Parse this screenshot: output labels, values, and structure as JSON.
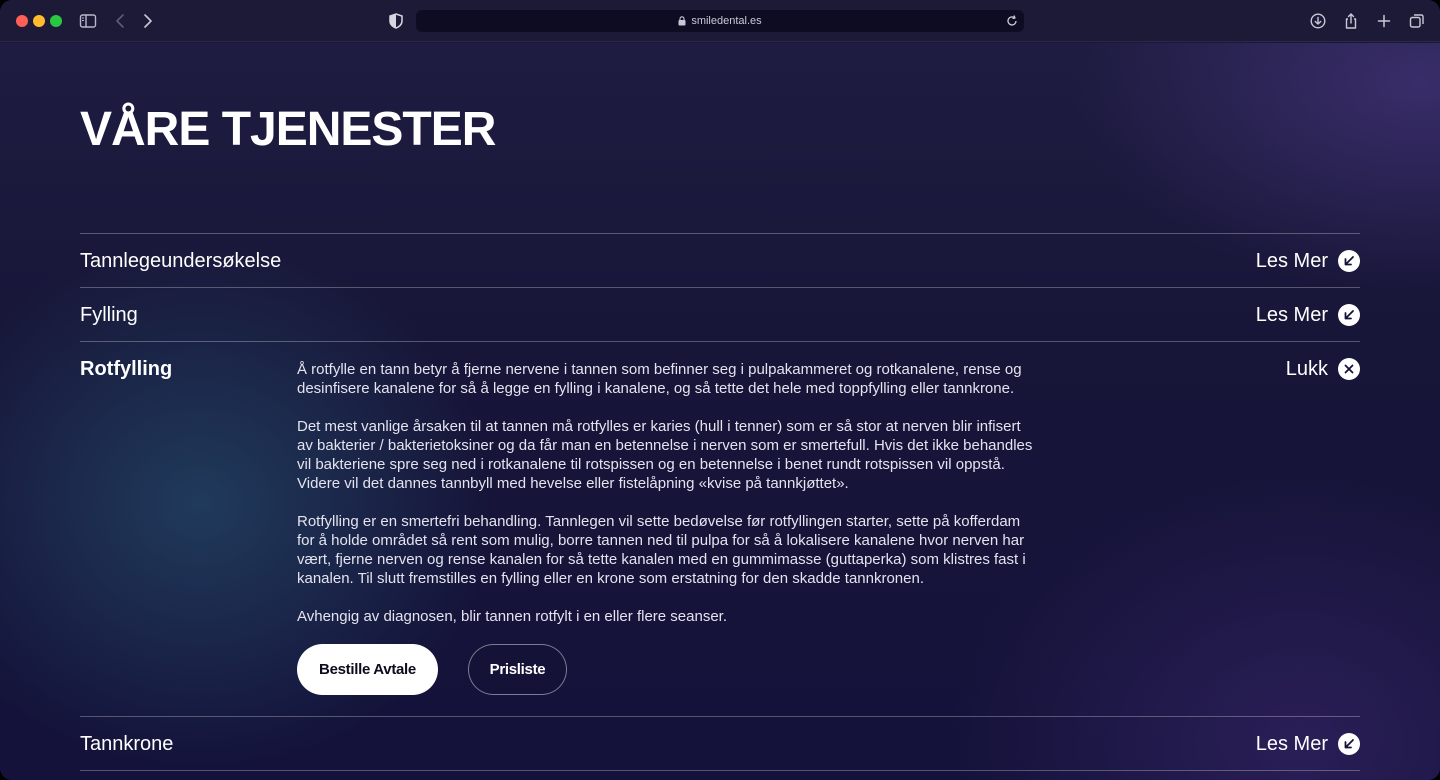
{
  "browser": {
    "url": "smiledental.es"
  },
  "page": {
    "title": "VÅRE TJENESTER"
  },
  "services": [
    {
      "name": "Tannlegeundersøkelse",
      "action": "Les Mer"
    },
    {
      "name": "Fylling",
      "action": "Les Mer"
    },
    {
      "name": "Rotfylling",
      "action": "Lukk",
      "paragraphs": [
        "Å rotfylle en tann betyr å fjerne nervene i tannen som befinner seg i pulpakammeret og rotkanalene, rense og desinfisere kanalene for så å legge en fylling i kanalene, og så tette det hele med toppfylling eller tannkrone.",
        "Det mest vanlige årsaken til at tannen må rotfylles er karies (hull i tenner) som er så stor at nerven blir infisert av bakterier / bakterietoksiner og da får man en betennelse i nerven som er smertefull. Hvis det ikke behandles vil bakteriene spre seg ned i rotkanalene til rotspissen og en betennelse i benet rundt rotspissen vil oppstå. Videre vil det dannes tannbyll med hevelse eller fistelåpning «kvise på tannkjøttet».",
        "Rotfylling er en smertefri behandling. Tannlegen vil sette bedøvelse før rotfyllingen starter, sette på kofferdam for å holde området så rent som mulig, borre tannen ned til pulpa for så å lokalisere kanalene hvor nerven har vært, fjerne nerven og rense kanalen for så tette kanalen med en gummimasse (guttaperka) som klistres fast i kanalen. Til slutt fremstilles en fylling eller en krone som erstatning for den skadde tannkronen.",
        "Avhengig av diagnosen, blir tannen rotfylt i en eller flere seanser."
      ],
      "buttons": {
        "primary": "Bestille Avtale",
        "secondary": "Prisliste"
      }
    },
    {
      "name": "Tannkrone",
      "action": "Les Mer"
    }
  ]
}
